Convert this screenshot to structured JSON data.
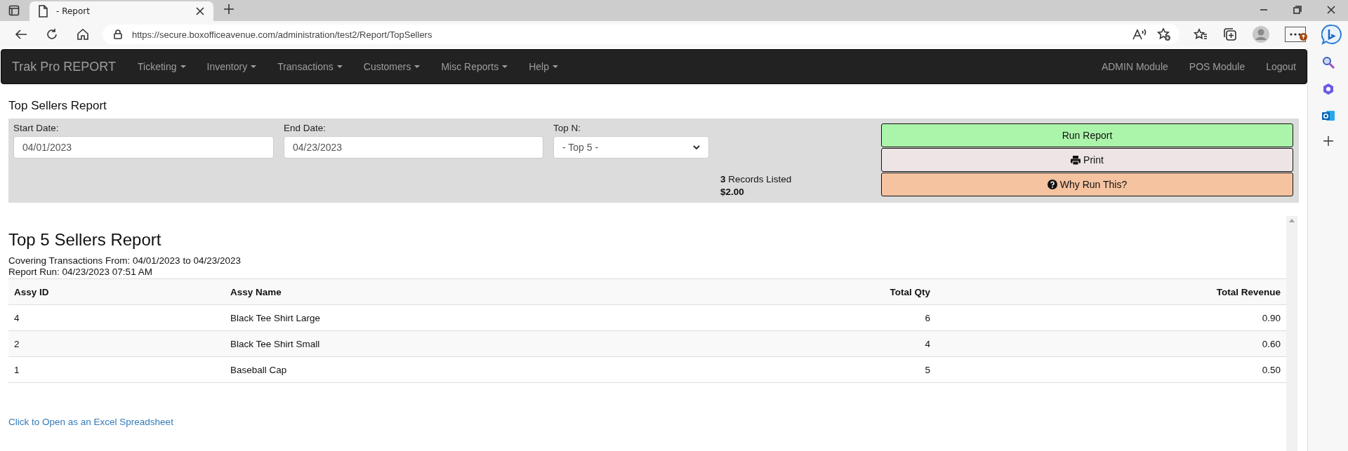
{
  "browser": {
    "tabs": [
      {
        "title": "- Report",
        "selected": true
      }
    ],
    "url": "https://secure.boxofficeavenue.com/administration/test2/Report/TopSellers"
  },
  "nav": {
    "brand": "Trak Pro REPORT",
    "menus": [
      {
        "label": "Ticketing",
        "dropdown": true
      },
      {
        "label": "Inventory",
        "dropdown": true
      },
      {
        "label": "Transactions",
        "dropdown": true
      },
      {
        "label": "Customers",
        "dropdown": true
      },
      {
        "label": "Misc Reports",
        "dropdown": true
      },
      {
        "label": "Help",
        "dropdown": true
      }
    ],
    "right_links": [
      "ADMIN Module",
      "POS Module",
      "Logout"
    ]
  },
  "page_title": "Top Sellers Report",
  "filters": {
    "start_date": {
      "label": "Start Date:",
      "value": "04/01/2023"
    },
    "end_date": {
      "label": "End Date:",
      "value": "04/23/2023"
    },
    "top_n": {
      "label": "Top N:",
      "value": "- Top 5 -"
    }
  },
  "summary": {
    "records": "**3** Records Listed",
    "total": "$2.00"
  },
  "buttons": [
    {
      "label": "Run Report",
      "kind": "run"
    },
    {
      "label": "Print",
      "kind": "print"
    },
    {
      "label": "Why Run This?",
      "kind": "help"
    }
  ],
  "report": {
    "title": "Top 5 Sellers Report",
    "covering": "Covering Transactions From: 04/01/2023 to 04/23/2023",
    "run": "Report Run: 04/23/2023 07:51 AM",
    "table": {
      "columns": [
        {
          "label": "Assy ID",
          "numeric": false
        },
        {
          "label": "Assy Name",
          "numeric": false
        },
        {
          "label": "Total Qty",
          "numeric": true
        },
        {
          "label": "Total Revenue",
          "numeric": true
        }
      ],
      "rows": [
        [
          "4",
          "Black Tee Shirt Large",
          "6",
          "0.90"
        ],
        [
          "2",
          "Black Tee Shirt Small",
          "4",
          "0.60"
        ],
        [
          "1",
          "Baseball Cap",
          "5",
          "0.50"
        ]
      ]
    },
    "excel_link": "Click to Open as an Excel Spreadsheet"
  }
}
